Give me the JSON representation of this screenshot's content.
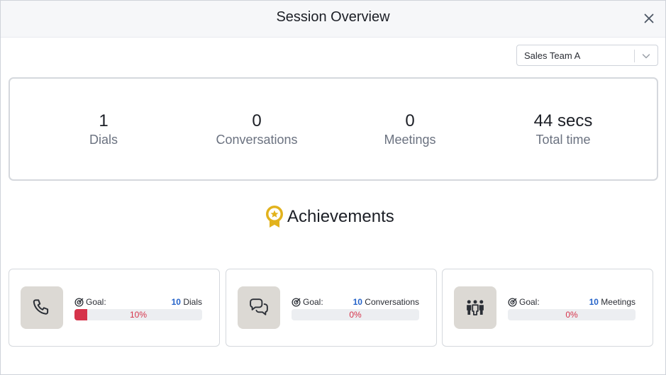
{
  "header": {
    "title": "Session Overview"
  },
  "team_select": {
    "value": "Sales Team A"
  },
  "stats": [
    {
      "value": "1",
      "label": "Dials"
    },
    {
      "value": "0",
      "label": "Conversations"
    },
    {
      "value": "0",
      "label": "Meetings"
    },
    {
      "value": "44 secs",
      "label": "Total time"
    }
  ],
  "achievements": {
    "title": "Achievements",
    "cards": [
      {
        "icon": "phone-icon",
        "goal_label": "Goal:",
        "goal_value": "10",
        "goal_unit": "Dials",
        "progress_pct": 10,
        "progress_text": "10%"
      },
      {
        "icon": "chat-bubbles-icon",
        "goal_label": "Goal:",
        "goal_value": "10",
        "goal_unit": "Conversations",
        "progress_pct": 0,
        "progress_text": "0%"
      },
      {
        "icon": "people-group-icon",
        "goal_label": "Goal:",
        "goal_value": "10",
        "goal_unit": "Meetings",
        "progress_pct": 0,
        "progress_text": "0%"
      }
    ]
  },
  "colors": {
    "accent_blue": "#2563c9",
    "progress_red": "#d6334a",
    "medal_gold": "#e2b21c",
    "icon_tile": "#dcd9d4"
  }
}
